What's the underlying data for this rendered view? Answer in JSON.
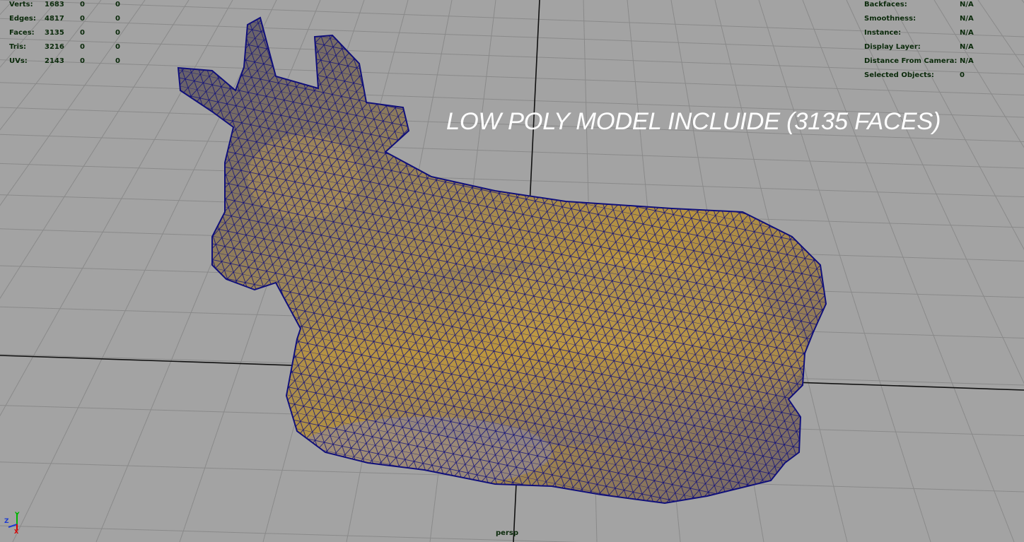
{
  "poly_count": {
    "rows": [
      {
        "label": "Verts:",
        "v1": "1683",
        "v2": "0",
        "v3": "0"
      },
      {
        "label": "Edges:",
        "v1": "4817",
        "v2": "0",
        "v3": "0"
      },
      {
        "label": "Faces:",
        "v1": "3135",
        "v2": "0",
        "v3": "0"
      },
      {
        "label": "Tris:",
        "v1": "3216",
        "v2": "0",
        "v3": "0"
      },
      {
        "label": "UVs:",
        "v1": "2143",
        "v2": "0",
        "v3": "0"
      }
    ]
  },
  "object_details": {
    "rows": [
      {
        "label": "Backfaces:",
        "value": "N/A"
      },
      {
        "label": "Smoothness:",
        "value": "N/A"
      },
      {
        "label": "Instance:",
        "value": "N/A"
      },
      {
        "label": "Display Layer:",
        "value": "N/A"
      },
      {
        "label": "Distance From Camera:",
        "value": "N/A"
      },
      {
        "label": "Selected Objects:",
        "value": "0"
      }
    ]
  },
  "caption": "LOW POLY MODEL INCLUIDE (3135 FACES)",
  "camera": "persp",
  "axis": {
    "y": "Y",
    "z": "Z",
    "x": "X"
  },
  "colors": {
    "grid_bg": "#a3a3a3",
    "grid_line": "#8a8a8a",
    "axis_line": "#111111",
    "wire": "#10107a",
    "hud_text": "#0b2a0b",
    "axis_x": "#d40000",
    "axis_y": "#00b400",
    "axis_z": "#1e3cd0"
  }
}
